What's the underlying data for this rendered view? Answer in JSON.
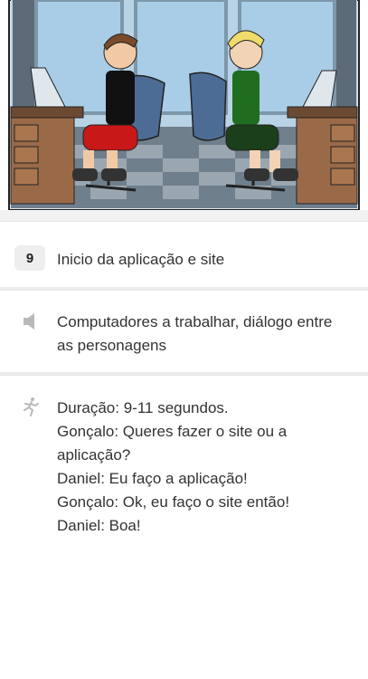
{
  "panel": {
    "scene_image": "two-characters-office-illustration",
    "number": "9",
    "title": "Inicio da aplicação e site",
    "sound_text": "Computadores a trabalhar, diálogo entre as personagens",
    "action_text": "Duração: 9-11 segundos.\nGonçalo: Queres fazer o site ou a aplicação?\nDaniel: Eu faço a aplicação!\nGonçalo: Ok, eu faço o site então!\nDaniel: Boa!",
    "icons": {
      "sound": "speaker-icon",
      "action": "running-figure-icon"
    }
  }
}
